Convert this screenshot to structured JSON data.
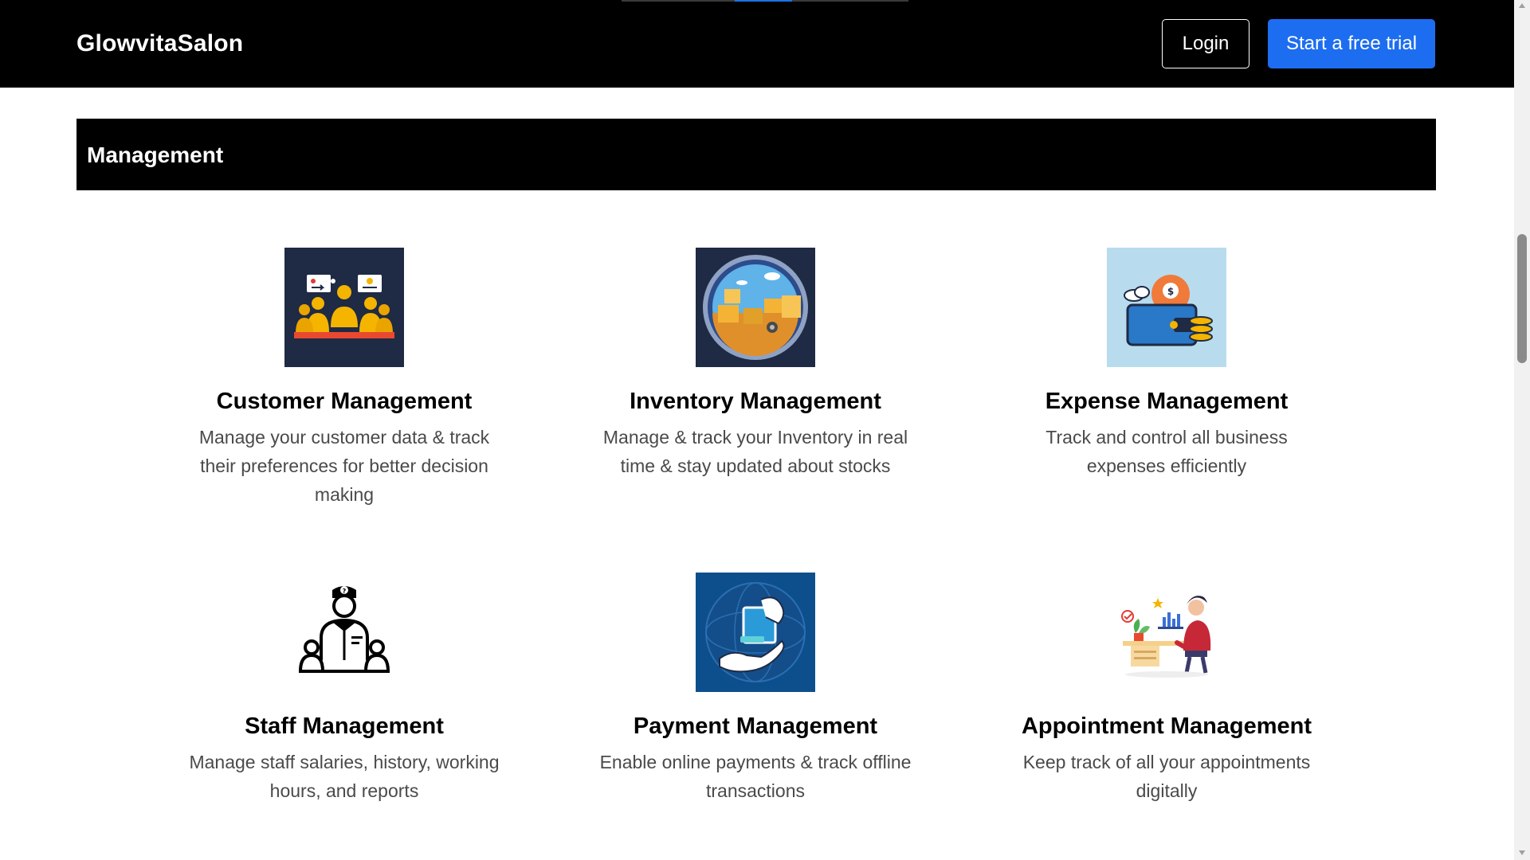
{
  "header": {
    "brand": "GlowvitaSalon",
    "login_label": "Login",
    "trial_label": "Start a free trial",
    "bg_color": "#000000",
    "trial_color": "#1d6df0"
  },
  "section": {
    "title": "Management"
  },
  "features": [
    {
      "title": "Customer Management",
      "description": "Manage your customer data & track their preferences for better decision making",
      "icon": "customer-group-icon"
    },
    {
      "title": "Inventory Management",
      "description": "Manage & track your Inventory in real time & stay updated about stocks",
      "icon": "inventory-boxes-icon"
    },
    {
      "title": "Expense Management",
      "description": "Track and control all business expenses efficiently",
      "icon": "expense-wallet-icon"
    },
    {
      "title": "Staff Management",
      "description": "Manage staff salaries, history, working hours, and reports",
      "icon": "staff-manager-icon"
    },
    {
      "title": "Payment Management",
      "description": "Enable online payments & track offline transactions",
      "icon": "payment-hand-icon"
    },
    {
      "title": "Appointment Management",
      "description": "Keep track of all your appointments digitally",
      "icon": "appointment-desk-icon"
    }
  ]
}
